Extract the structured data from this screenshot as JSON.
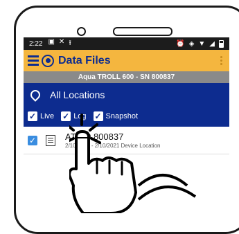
{
  "status_bar": {
    "time": "2:22"
  },
  "app_bar": {
    "title": "Data Files"
  },
  "device": {
    "label": "Aqua TROLL 600 - SN 800837"
  },
  "locations": {
    "label": "All Locations"
  },
  "filters": [
    {
      "label": "Live",
      "checked": true
    },
    {
      "label": "Log",
      "checked": true
    },
    {
      "label": "Snapshot",
      "checked": true
    }
  ],
  "files": [
    {
      "name": "AT600 800837",
      "date_start": "2/10/2021",
      "date_end": "2/10/2021",
      "location": "Device Location",
      "checked": true
    }
  ],
  "colors": {
    "appbar": "#f4b63f",
    "brand_blue": "#0d2c8f",
    "device_bar": "#8a8a8a",
    "checkbox_selected": "#3a8de0"
  }
}
